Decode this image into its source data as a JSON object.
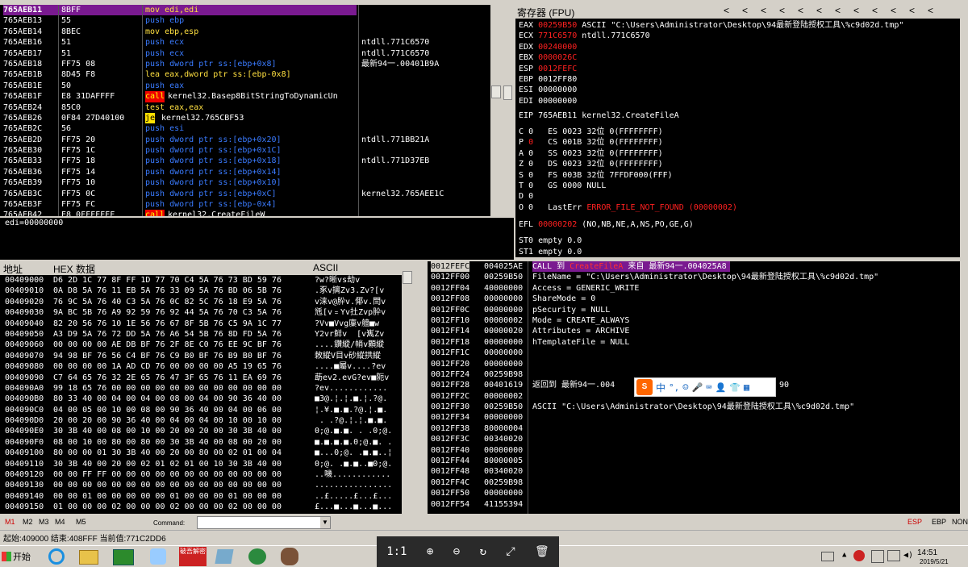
{
  "disasm": {
    "rows": [
      {
        "addr": "765AEB11",
        "hex": "8BFF",
        "instr": "mov edi,edi",
        "cmt": "",
        "type": "yellow",
        "sel": true
      },
      {
        "addr": "765AEB13",
        "hex": "55",
        "instr": "push ebp",
        "cmt": "",
        "type": "push"
      },
      {
        "addr": "765AEB14",
        "hex": "8BEC",
        "instr": "mov ebp,esp",
        "cmt": "",
        "type": "yellow"
      },
      {
        "addr": "765AEB16",
        "hex": "51",
        "instr": "push ecx",
        "cmt": "ntdll.771C6570",
        "type": "push"
      },
      {
        "addr": "765AEB17",
        "hex": "51",
        "instr": "push ecx",
        "cmt": "ntdll.771C6570",
        "type": "push"
      },
      {
        "addr": "765AEB18",
        "hex": "FF75 08",
        "instr": "push dword ptr ss:[ebp+0x8]",
        "cmt": "最新94一.00401B9A",
        "type": "push"
      },
      {
        "addr": "765AEB1B",
        "hex": "8D45 F8",
        "instr": "lea eax,dword ptr ss:[ebp-0x8]",
        "cmt": "",
        "type": "yellow"
      },
      {
        "addr": "765AEB1E",
        "hex": "50",
        "instr": "push eax",
        "cmt": "",
        "type": "push"
      },
      {
        "addr": "765AEB1F",
        "hex": "E8 31DAFFFF",
        "instr": "kernel32.Basep8BitStringToDynamicUn",
        "mn": "call",
        "cmt": "",
        "type": "call"
      },
      {
        "addr": "765AEB24",
        "hex": "85C0",
        "instr": "test eax,eax",
        "cmt": "",
        "type": "yellow"
      },
      {
        "addr": "765AEB26",
        "hex": "0F84 27D40100",
        "instr": "kernel32.765CBF53",
        "mn": "je",
        "cmt": "",
        "type": "je"
      },
      {
        "addr": "765AEB2C",
        "hex": "56",
        "instr": "push esi",
        "cmt": "",
        "type": "push"
      },
      {
        "addr": "765AEB2D",
        "hex": "FF75 20",
        "instr": "push dword ptr ss:[ebp+0x20]",
        "cmt": "ntdll.771BB21A",
        "type": "push"
      },
      {
        "addr": "765AEB30",
        "hex": "FF75 1C",
        "instr": "push dword ptr ss:[ebp+0x1C]",
        "cmt": "",
        "type": "push"
      },
      {
        "addr": "765AEB33",
        "hex": "FF75 18",
        "instr": "push dword ptr ss:[ebp+0x18]",
        "cmt": "ntdll.771D37EB",
        "type": "push"
      },
      {
        "addr": "765AEB36",
        "hex": "FF75 14",
        "instr": "push dword ptr ss:[ebp+0x14]",
        "cmt": "",
        "type": "push"
      },
      {
        "addr": "765AEB39",
        "hex": "FF75 10",
        "instr": "push dword ptr ss:[ebp+0x10]",
        "cmt": "",
        "type": "push"
      },
      {
        "addr": "765AEB3C",
        "hex": "FF75 0C",
        "instr": "push dword ptr ss:[ebp+0xC]",
        "cmt": "kernel32.765AEE1C",
        "type": "push"
      },
      {
        "addr": "765AEB3F",
        "hex": "FF75 FC",
        "instr": "push dword ptr ss:[ebp-0x4]",
        "cmt": "",
        "type": "push"
      },
      {
        "addr": "765AEB42",
        "hex": "E8 0FFFFFFF",
        "instr": "kernel32.CreateFileW",
        "mn": "call",
        "cmt": "",
        "type": "call"
      }
    ],
    "info_line": "edi=00000000"
  },
  "registers": {
    "title": "寄存器 (FPU)",
    "arrows": [
      "<",
      "<",
      "<",
      "<",
      "<",
      "<",
      "<",
      "<",
      "<",
      "<",
      "<",
      "<"
    ],
    "gp": [
      {
        "name": "EAX",
        "val": "00259B50",
        "note": "ASCII \"C:\\Users\\Administrator\\Desktop\\94最新登陆授权工具\\%c9d02d.tmp\"",
        "red": true
      },
      {
        "name": "ECX",
        "val": "771C6570",
        "note": "ntdll.771C6570",
        "red": true
      },
      {
        "name": "EDX",
        "val": "00240000",
        "note": "",
        "red": true
      },
      {
        "name": "EBX",
        "val": "0000026C",
        "note": "",
        "red": true
      },
      {
        "name": "ESP",
        "val": "0012FEFC",
        "note": "",
        "red": true
      },
      {
        "name": "EBP",
        "val": "0012FF80",
        "note": "",
        "red": false
      },
      {
        "name": "ESI",
        "val": "00000000",
        "note": "",
        "red": false
      },
      {
        "name": "EDI",
        "val": "00000000",
        "note": "",
        "red": false
      }
    ],
    "eip": "EIP 765AEB11 kernel32.CreateFileA",
    "segs": [
      {
        "f": "C",
        "v": "0",
        "t": "ES 0023 32位 0(FFFFFFFF)",
        "red": false
      },
      {
        "f": "P",
        "v": "0",
        "t": "CS 001B 32位 0(FFFFFFFF)",
        "red": true
      },
      {
        "f": "A",
        "v": "0",
        "t": "SS 0023 32位 0(FFFFFFFF)",
        "red": false
      },
      {
        "f": "Z",
        "v": "0",
        "t": "DS 0023 32位 0(FFFFFFFF)",
        "red": false
      },
      {
        "f": "S",
        "v": "0",
        "t": "FS 003B 32位 7FFDF000(FFF)",
        "red": false
      },
      {
        "f": "T",
        "v": "0",
        "t": "GS 0000 NULL",
        "red": false
      },
      {
        "f": "D",
        "v": "0",
        "t": "",
        "red": false
      }
    ],
    "lasterr_label": "O 0   LastErr",
    "lasterr_val": "ERROR_FILE_NOT_FOUND (00000002)",
    "efl_label": "EFL",
    "efl_val": "00000202",
    "efl_note": "(NO,NB,NE,A,NS,PO,GE,G)",
    "st": [
      "ST0 empty 0.0",
      "ST1 empty 0.0"
    ]
  },
  "hexdump": {
    "col_addr": "地址",
    "col_hex": "HEX 数据",
    "col_ascii": "ASCII",
    "rows": [
      {
        "a": "00409000",
        "h": "D6 2D 1C 77 8F FF 1D 77 70 C4 5A 76 73 BD 59 76",
        "s": "?w?晰vs劫v"
      },
      {
        "a": "00409010",
        "h": "0A D8 5A 76 11 EB 5A 76 33 09 5A 76 BD 06 5B 76",
        "s": ".豖v摛Zv3.Zv?[v"
      },
      {
        "a": "00409020",
        "h": "76 9C 5A 76 40 C3 5A 76 0C 82 5C 76 18 E9 5A 76",
        "s": "v涞v@肸v.倻v.閆v"
      },
      {
        "a": "00409030",
        "h": "9A BC 5B 76 A9 92 59 76 92 44 5A 76 70 C3 5A 76",
        "s": "毤[v﹦Yv扗Zvp肸v"
      },
      {
        "a": "00409040",
        "h": "82 20 56 76 10 1E 56 76 67 8F 5B 76 C5 9A 1C 77",
        "s": "?Vv■Vvg廩v艢■w"
      },
      {
        "a": "00409050",
        "h": "A3 D9 5A 76 72 DD 5A 76 A6 54 5B 76 8D FD 5A 76",
        "s": "Y2vr鲜v  [v嶲Zv"
      },
      {
        "a": "00409060",
        "h": "00 00 00 00 AE DB BF 76 2F 8E C0 76 EE 9C BF 76",
        "s": "....鑽縱/帩v顆縱"
      },
      {
        "a": "00409070",
        "h": "94 98 BF 76 56 C4 BF 76 C9 B0 BF 76 B9 B0 BF 76",
        "s": "敇縱V目v砂縱拱縱"
      },
      {
        "a": "00409080",
        "h": "00 00 00 00 1A AD CD 76 00 00 00 00 A5 19 65 76",
        "s": "....■屬v....?ev"
      },
      {
        "a": "00409090",
        "h": "C7 64 65 76 32 2E 65 76 47 3F 65 76 11 EA 69 76",
        "s": "莇ev2.evG?ev■阨v"
      },
      {
        "a": "004090A0",
        "h": "99 18 65 76 00 00 00 00 00 00 00 00 00 00 00 00",
        "s": "?ev............"
      },
      {
        "a": "004090B0",
        "h": "80 33 40 00 04 00 04 00 08 00 04 00 90 36 40 00",
        "s": "■3@.¦.¦.■.¦.?@."
      },
      {
        "a": "004090C0",
        "h": "04 00 05 00 10 00 08 00 90 36 40 00 04 00 06 00",
        "s": "¦.¥.■.■.?@.¦.■."
      },
      {
        "a": "004090D0",
        "h": "20 00 20 00 90 36 40 00 04 00 04 00 10 00 10 00",
        "s": " . .?@.¦.¦.■.■."
      },
      {
        "a": "004090E0",
        "h": "30 3B 40 00 08 00 10 00 20 00 20 00 30 3B 40 00",
        "s": "0;@.■.■. . .0;@."
      },
      {
        "a": "004090F0",
        "h": "08 00 10 00 80 00 80 00 30 3B 40 00 08 00 20 00",
        "s": "■.■.■.■.0;@.■. ."
      },
      {
        "a": "00409100",
        "h": "80 00 00 01 30 3B 40 00 20 00 80 00 02 01 00 04",
        "s": "■...0;@. .■.■..¦"
      },
      {
        "a": "00409110",
        "h": "30 3B 40 00 20 00 02 01 02 01 00 10 30 3B 40 00",
        "s": "0;@. .■.■..■0;@."
      },
      {
        "a": "00409120",
        "h": "00 00 FF FF 00 00 00 00 00 00 00 00 00 00 00 00",
        "s": "..嘰............"
      },
      {
        "a": "00409130",
        "h": "00 00 00 00 00 00 00 00 00 00 00 00 00 00 00 00",
        "s": "................"
      },
      {
        "a": "00409140",
        "h": "00 00 01 00 00 00 00 00 01 00 00 00 01 00 00 00",
        "s": "..£.....£...£..."
      },
      {
        "a": "00409150",
        "h": "01 00 00 00 02 00 00 00 02 00 00 00 02 00 00 00",
        "s": "£...■...■...■..."
      }
    ]
  },
  "stack": {
    "rows": [
      {
        "a": "0012FEFC",
        "v": "004025AE",
        "c": "CALL 到 CreateFileA 来自 最新94一.004025A8",
        "hl": true
      },
      {
        "a": "0012FF00",
        "v": "00259B50",
        "c": "FileName = \"C:\\Users\\Administrator\\Desktop\\94最新登陆授权工具\\%c9d02d.tmp\""
      },
      {
        "a": "0012FF04",
        "v": "40000000",
        "c": "Access = GENERIC_WRITE"
      },
      {
        "a": "0012FF08",
        "v": "00000000",
        "c": "ShareMode = 0"
      },
      {
        "a": "0012FF0C",
        "v": "00000000",
        "c": "pSecurity = NULL"
      },
      {
        "a": "0012FF10",
        "v": "00000002",
        "c": "Mode = CREATE_ALWAYS"
      },
      {
        "a": "0012FF14",
        "v": "00000020",
        "c": "Attributes = ARCHIVE"
      },
      {
        "a": "0012FF18",
        "v": "00000000",
        "c": "hTemplateFile = NULL"
      },
      {
        "a": "0012FF1C",
        "v": "00000000",
        "c": ""
      },
      {
        "a": "0012FF20",
        "v": "00000000",
        "c": ""
      },
      {
        "a": "0012FF24",
        "v": "00259B98",
        "c": ""
      },
      {
        "a": "0012FF28",
        "v": "00401619",
        "c": "返回到 最新94一.004"
      },
      {
        "a": "0012FF2C",
        "v": "00000002",
        "c": ""
      },
      {
        "a": "0012FF30",
        "v": "00259B50",
        "c": "ASCII \"C:\\Users\\Administrator\\Desktop\\94最新登陆授权工具\\%c9d02d.tmp\""
      },
      {
        "a": "0012FF34",
        "v": "00000000",
        "c": ""
      },
      {
        "a": "0012FF38",
        "v": "80000004",
        "c": ""
      },
      {
        "a": "0012FF3C",
        "v": "00340020",
        "c": ""
      },
      {
        "a": "0012FF40",
        "v": "00000000",
        "c": ""
      },
      {
        "a": "0012FF44",
        "v": "80000005",
        "c": ""
      },
      {
        "a": "0012FF48",
        "v": "00340020",
        "c": ""
      },
      {
        "a": "0012FF4C",
        "v": "00259B98",
        "c": ""
      },
      {
        "a": "0012FF50",
        "v": "00000000",
        "c": ""
      },
      {
        "a": "0012FF54",
        "v": "41155394",
        "c": ""
      }
    ],
    "ret_suffix": "90"
  },
  "ime": {
    "logo": "S",
    "items": [
      "中",
      "°,",
      "☺",
      "🎤",
      "⌨",
      "👤",
      "👕",
      "▦"
    ]
  },
  "command": {
    "tabs": [
      "M1",
      "M2",
      "M3",
      "M4",
      "M5"
    ],
    "label": "Command:",
    "value": "",
    "right": [
      "ESP",
      "EBP",
      "NONE"
    ]
  },
  "status": "起始:409000 结束:408FFF 当前值:771C2DD6",
  "taskbar": {
    "start": "开始",
    "viewer": [
      "1:1",
      "⊕",
      "⊖",
      "↻",
      "⤢",
      "🗑"
    ],
    "time": "14:51",
    "date": "2019/5/21",
    "app_label": "破吾解密"
  }
}
